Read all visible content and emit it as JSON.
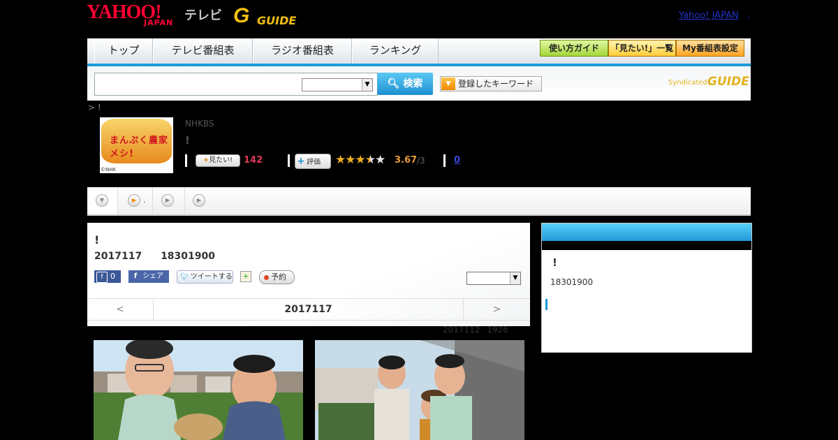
{
  "header": {
    "logo_main": "YAHOO!",
    "logo_sub": "JAPAN",
    "logo_tv": "テレビ",
    "gguide_logo": "GUIDE",
    "yj_link": "Yahoo! JAPAN",
    "yj_sep": "."
  },
  "nav": {
    "tabs": [
      "トップ",
      "テレビ番組表",
      "ラジオ番組表",
      "ランキング"
    ],
    "buttons": [
      "使い方ガイド",
      "「見たい!」一覧",
      "My番組表設定"
    ],
    "button_colors": [
      "#b8e64a",
      "#ffd85a",
      "#ffb33a"
    ]
  },
  "search": {
    "placeholder": "",
    "button_label": "検索",
    "keyword_button_label": "登録したキーワード",
    "syndicated_label": "Syndicated",
    "syndicated_logo": "GUIDE"
  },
  "breadcrumb": "> !",
  "program": {
    "thumb_title": "まんぷく農家メシ!",
    "thumb_credit": "©NHK",
    "channel": "NHKBS",
    "title": "!",
    "want_label": "見たい!",
    "want_count": "142",
    "rate_label": "評価",
    "rating_stars": 3.67,
    "rating": "3.67",
    "rating_of": "/3",
    "reviews": "0"
  },
  "detail": {
    "title": "!",
    "date_line": "2017117 18301900",
    "fb_count": "0",
    "fb_share": "シェア",
    "tweet": "ツイートする",
    "reserve": "予約",
    "prev": "<",
    "nav_date": "2017117",
    "next": ">",
    "updated": "2017112 1926"
  },
  "sidebar": {
    "title": "!",
    "time": "18301900"
  },
  "colors": {
    "accent_blue": "#1e9bd7",
    "want_pink": "#e0385a",
    "rating_orange": "#e89a38",
    "link_blue": "#3a46e0"
  }
}
